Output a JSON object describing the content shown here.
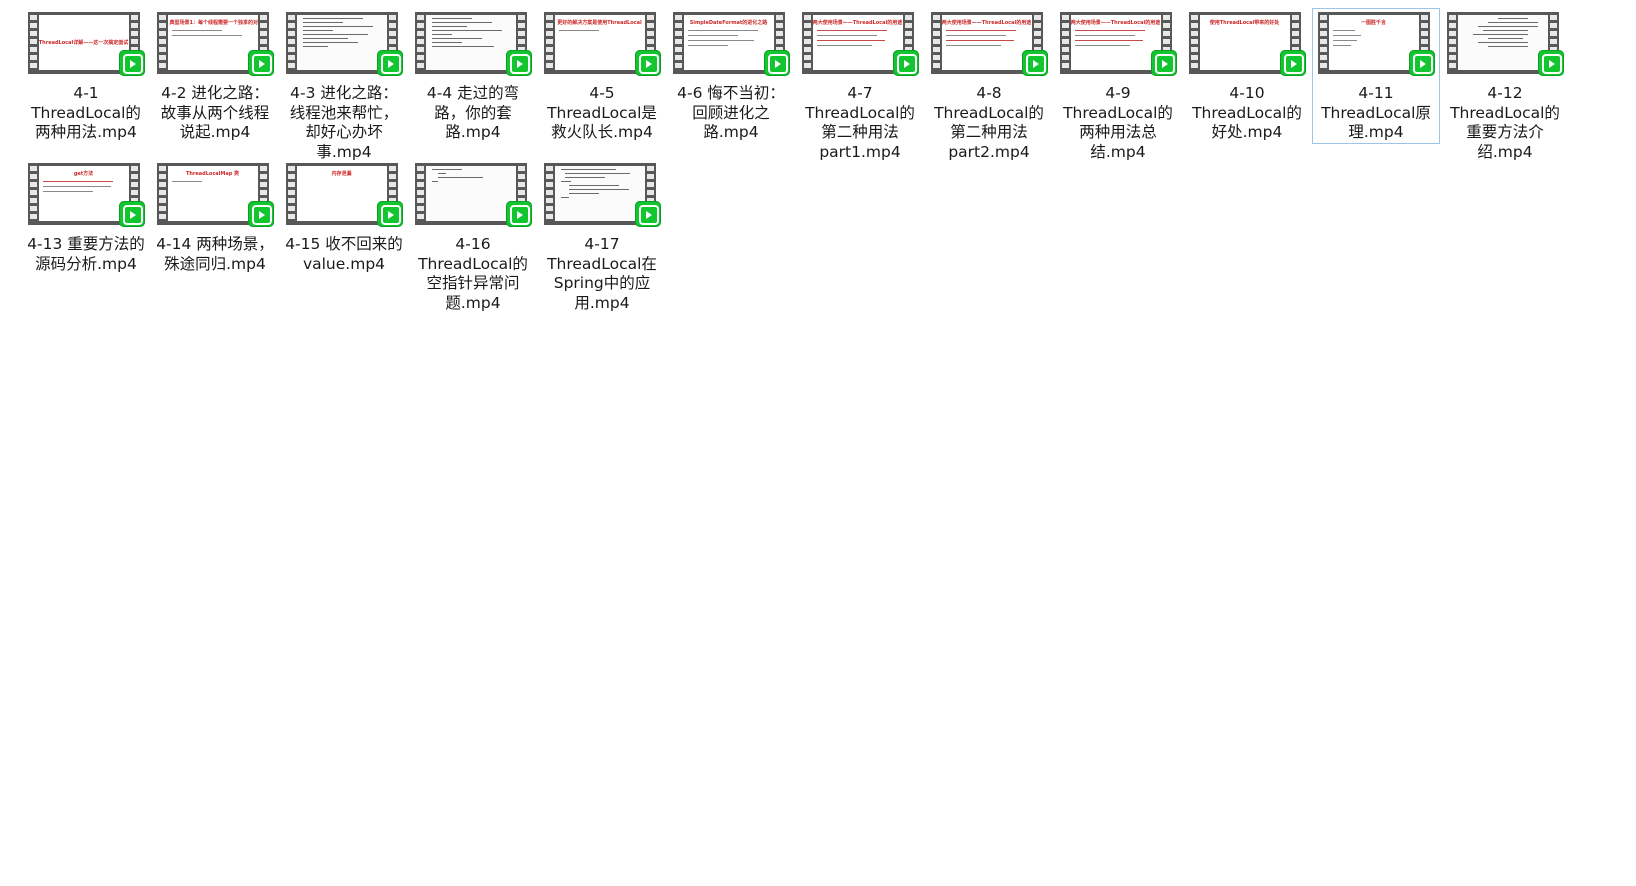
{
  "files": [
    {
      "label": "4-1 ThreadLocal的两种用法.mp4",
      "thumb_title": "ThreadLocal详解——这一次搞定面试"
    },
    {
      "label": "4-2 进化之路：故事从两个线程说起.mp4",
      "thumb_title": "典型场景1：每个线程需要一个独享的对象"
    },
    {
      "label": "4-3 进化之路：线程池来帮忙，却好心办坏事.mp4",
      "thumb_title": ""
    },
    {
      "label": "4-4 走过的弯路，你的套路.mp4",
      "thumb_title": ""
    },
    {
      "label": "4-5 ThreadLocal是救火队长.mp4",
      "thumb_title": "更好的解决方案是使用ThreadLocal"
    },
    {
      "label": "4-6 悔不当初：回顾进化之路.mp4",
      "thumb_title": "SimpleDateFormat的进化之路"
    },
    {
      "label": "4-7 ThreadLocal的第二种用法part1.mp4",
      "thumb_title": "两大使用场景——ThreadLocal的用途"
    },
    {
      "label": "4-8 ThreadLocal的第二种用法part2.mp4",
      "thumb_title": "两大使用场景——ThreadLocal的用途"
    },
    {
      "label": "4-9 ThreadLocal的两种用法总结.mp4",
      "thumb_title": "两大使用场景——ThreadLocal的用途"
    },
    {
      "label": "4-10 ThreadLocal的好处.mp4",
      "thumb_title": "使用ThreadLocal带来的好处"
    },
    {
      "label": "4-11 ThreadLocal原理.mp4",
      "thumb_title": "一图胜千言"
    },
    {
      "label": "4-12 ThreadLocal的重要方法介绍.mp4",
      "thumb_title": ""
    },
    {
      "label": "4-13 重要方法的源码分析.mp4",
      "thumb_title": "get方法"
    },
    {
      "label": "4-14 两种场景，殊途同归.mp4",
      "thumb_title": "ThreadLocalMap 类"
    },
    {
      "label": "4-15 收不回来的value.mp4",
      "thumb_title": "内存泄漏"
    },
    {
      "label": "4-16 ThreadLocal的空指针异常问题.mp4",
      "thumb_title": ""
    },
    {
      "label": "4-17 ThreadLocal在Spring中的应用.mp4",
      "thumb_title": ""
    }
  ],
  "selected_file": "4-11 ThreadLocal原理.mp4",
  "badge_icon": "video-player-icon",
  "colors": {
    "badge": "#12c630",
    "film": "#585858",
    "selection_border": "#9ec5e8",
    "thumb_title": "#cc2a2a"
  }
}
